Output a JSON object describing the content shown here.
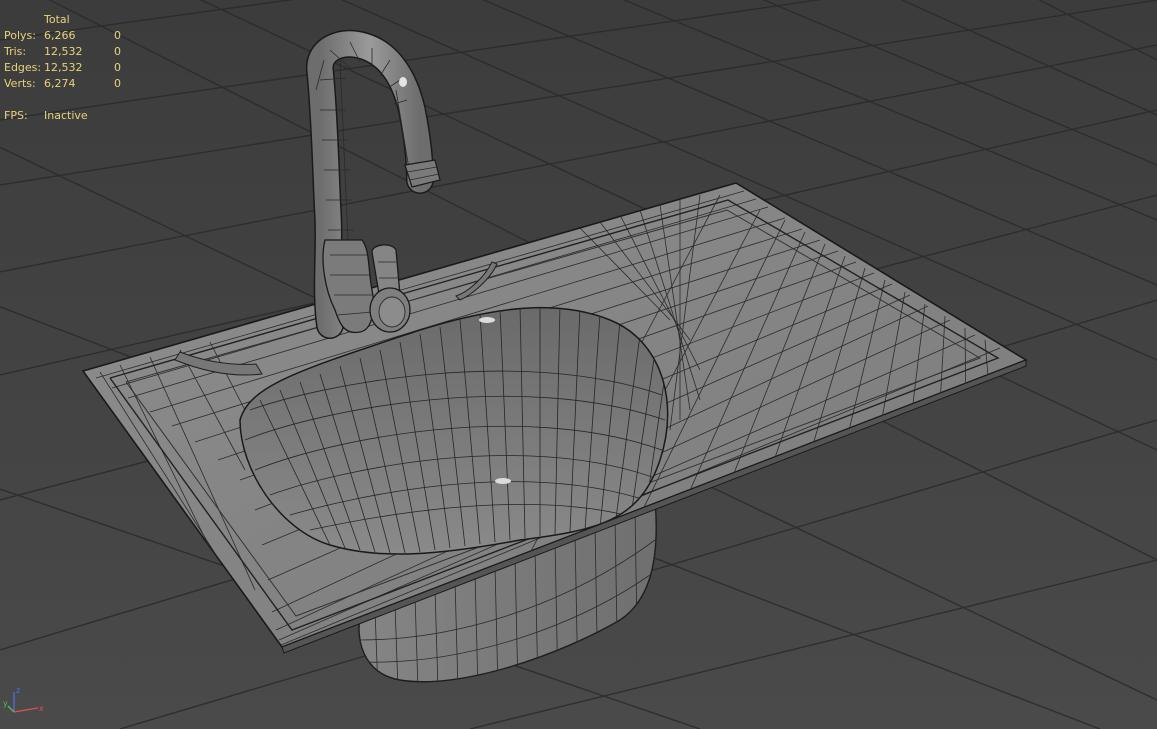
{
  "stats": {
    "header": "Total",
    "rows": [
      {
        "label": "Polys:",
        "total": "6,266",
        "selected": "0"
      },
      {
        "label": "Tris:",
        "total": "12,532",
        "selected": "0"
      },
      {
        "label": "Edges:",
        "total": "12,532",
        "selected": "0"
      },
      {
        "label": "Verts:",
        "total": "6,274",
        "selected": "0"
      }
    ],
    "fps_label": "FPS:",
    "fps_value": "Inactive"
  },
  "axis": {
    "x": "x",
    "y": "y",
    "z": "z"
  },
  "colors": {
    "stats_text": "#e8d27a",
    "axis_x": "#e05050",
    "axis_y": "#50c050",
    "axis_z": "#5070e0"
  }
}
